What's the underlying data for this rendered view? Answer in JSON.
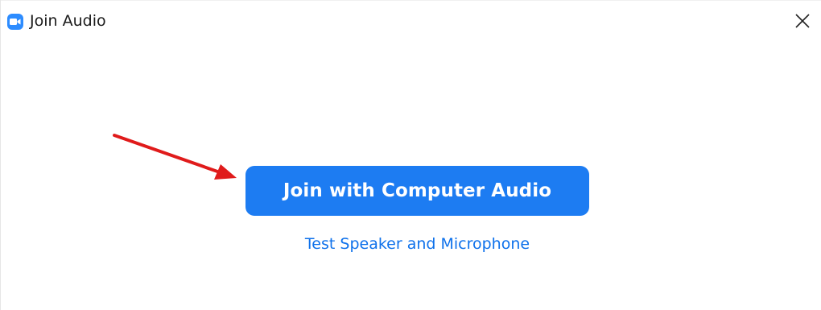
{
  "window": {
    "title": "Join Audio",
    "app_icon": "zoom-camera-icon",
    "close_icon": "close-icon"
  },
  "main": {
    "join_button_label": "Join with Computer Audio",
    "test_link_label": "Test Speaker and Microphone"
  },
  "annotation": {
    "arrow_icon": "red-arrow-icon",
    "arrow_color": "#e01b1b"
  },
  "colors": {
    "accent": "#1d7cf2",
    "link": "#0e71eb",
    "app_icon_bg": "#2d8cff"
  }
}
